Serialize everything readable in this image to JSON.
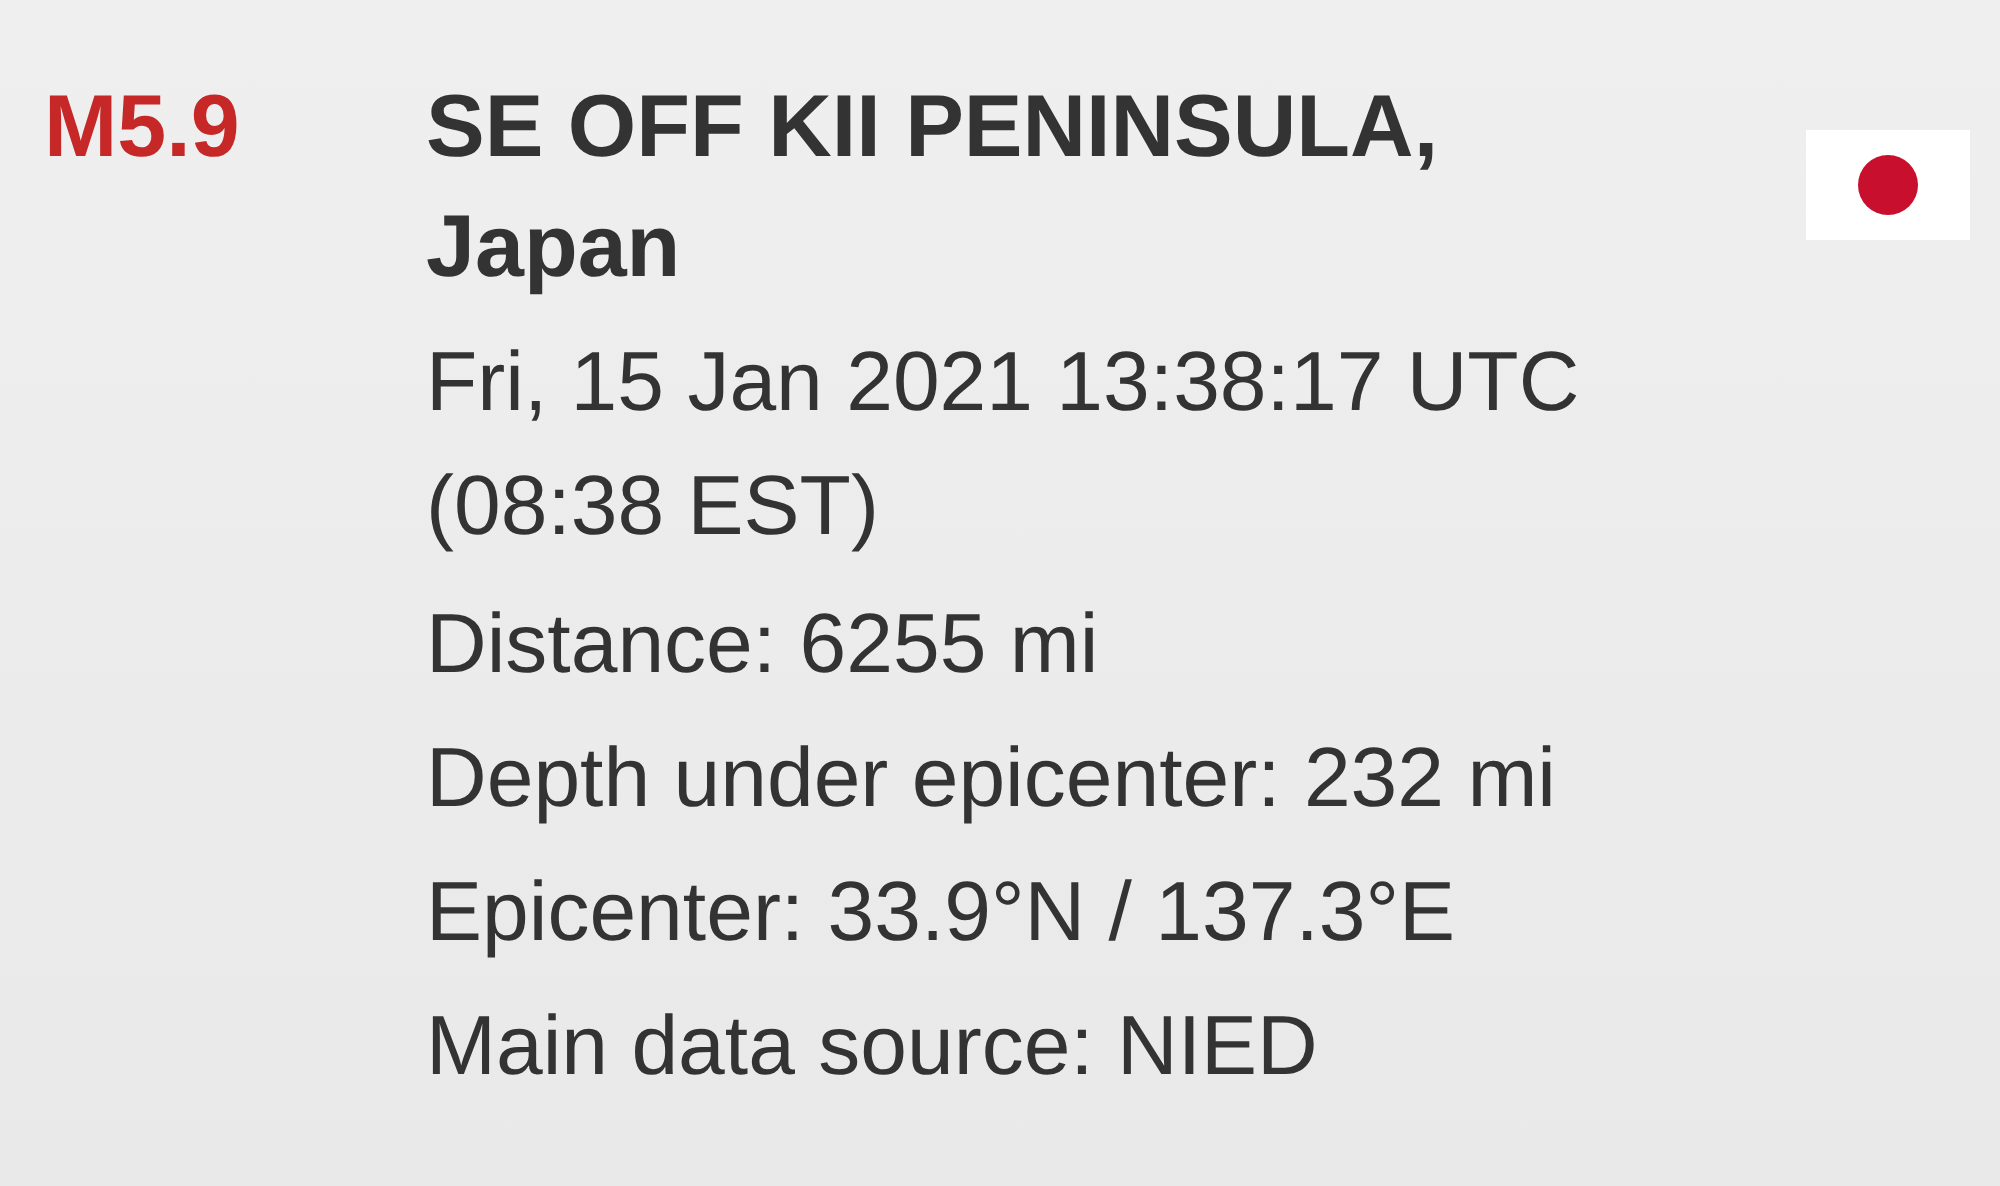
{
  "quake": {
    "magnitude": "M5.9",
    "region": "SE OFF KII PENINSULA, Japan",
    "time": "Fri, 15 Jan 2021 13:38:17 UTC (08:38 EST)",
    "details": [
      "Distance: 6255 mi",
      "Depth under epicenter: 232 mi",
      "Epicenter: 33.9°N / 137.3°E",
      "Main data source: NIED"
    ]
  }
}
